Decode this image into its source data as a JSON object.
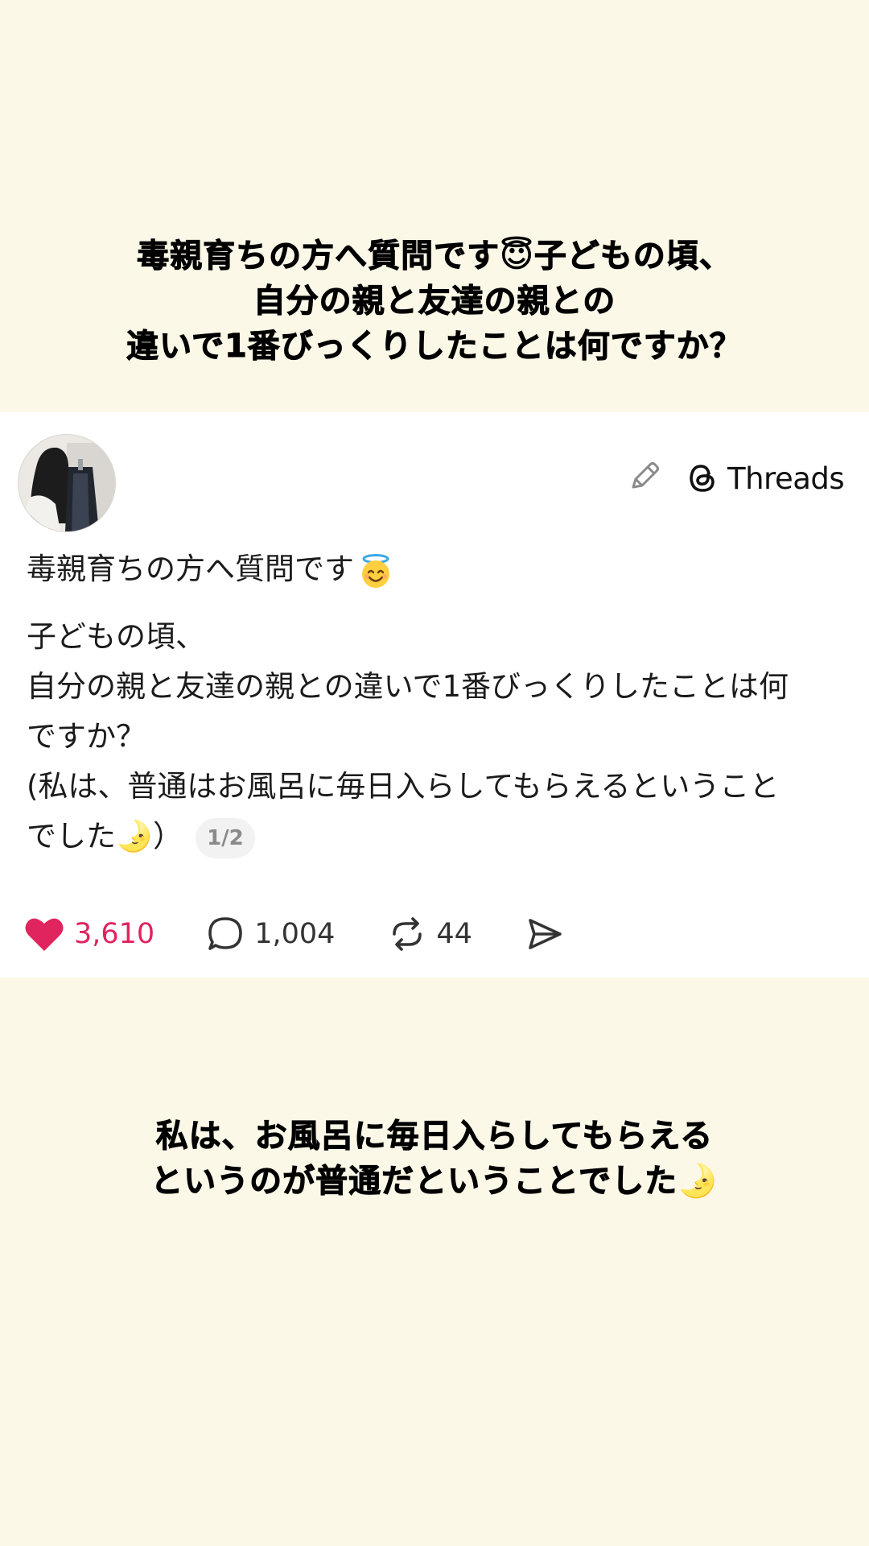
{
  "top_caption": {
    "lines": [
      "毒親育ちの方へ質問です😇子どもの頃、",
      "自分の親と友達の親との",
      "違いで1番びっくりしたことは何ですか？"
    ]
  },
  "post": {
    "brand_name": "Threads",
    "first_line": "毒親育ちの方へ質問です",
    "body_lines": [
      "子どもの頃、",
      "自分の親と友達の親との違いで1番びっくりしたことは何",
      "ですか？",
      "(私は、普通はお風呂に毎日入らしてもらえるということ",
      "でした🌛）"
    ],
    "page_indicator": "1/2",
    "stats": {
      "likes": "3,610",
      "replies": "1,004",
      "reposts": "44"
    },
    "icons": {
      "avatar": "avatar",
      "edit": "pencil-icon",
      "brand": "threads-logo-icon",
      "emoji": "smiling-face-with-halo-emoji",
      "like": "heart-icon",
      "reply": "comment-bubble-icon",
      "repost": "repost-icon",
      "share": "send-icon"
    },
    "colors": {
      "like": "#e0245e",
      "text": "#1b1b1b",
      "page_bg": "#fcf8e8",
      "card_bg": "#ffffff"
    }
  },
  "bottom_caption": {
    "lines": [
      "私は、お風呂に毎日入らしてもらえる",
      "というのが普通だということでした🌛"
    ]
  }
}
